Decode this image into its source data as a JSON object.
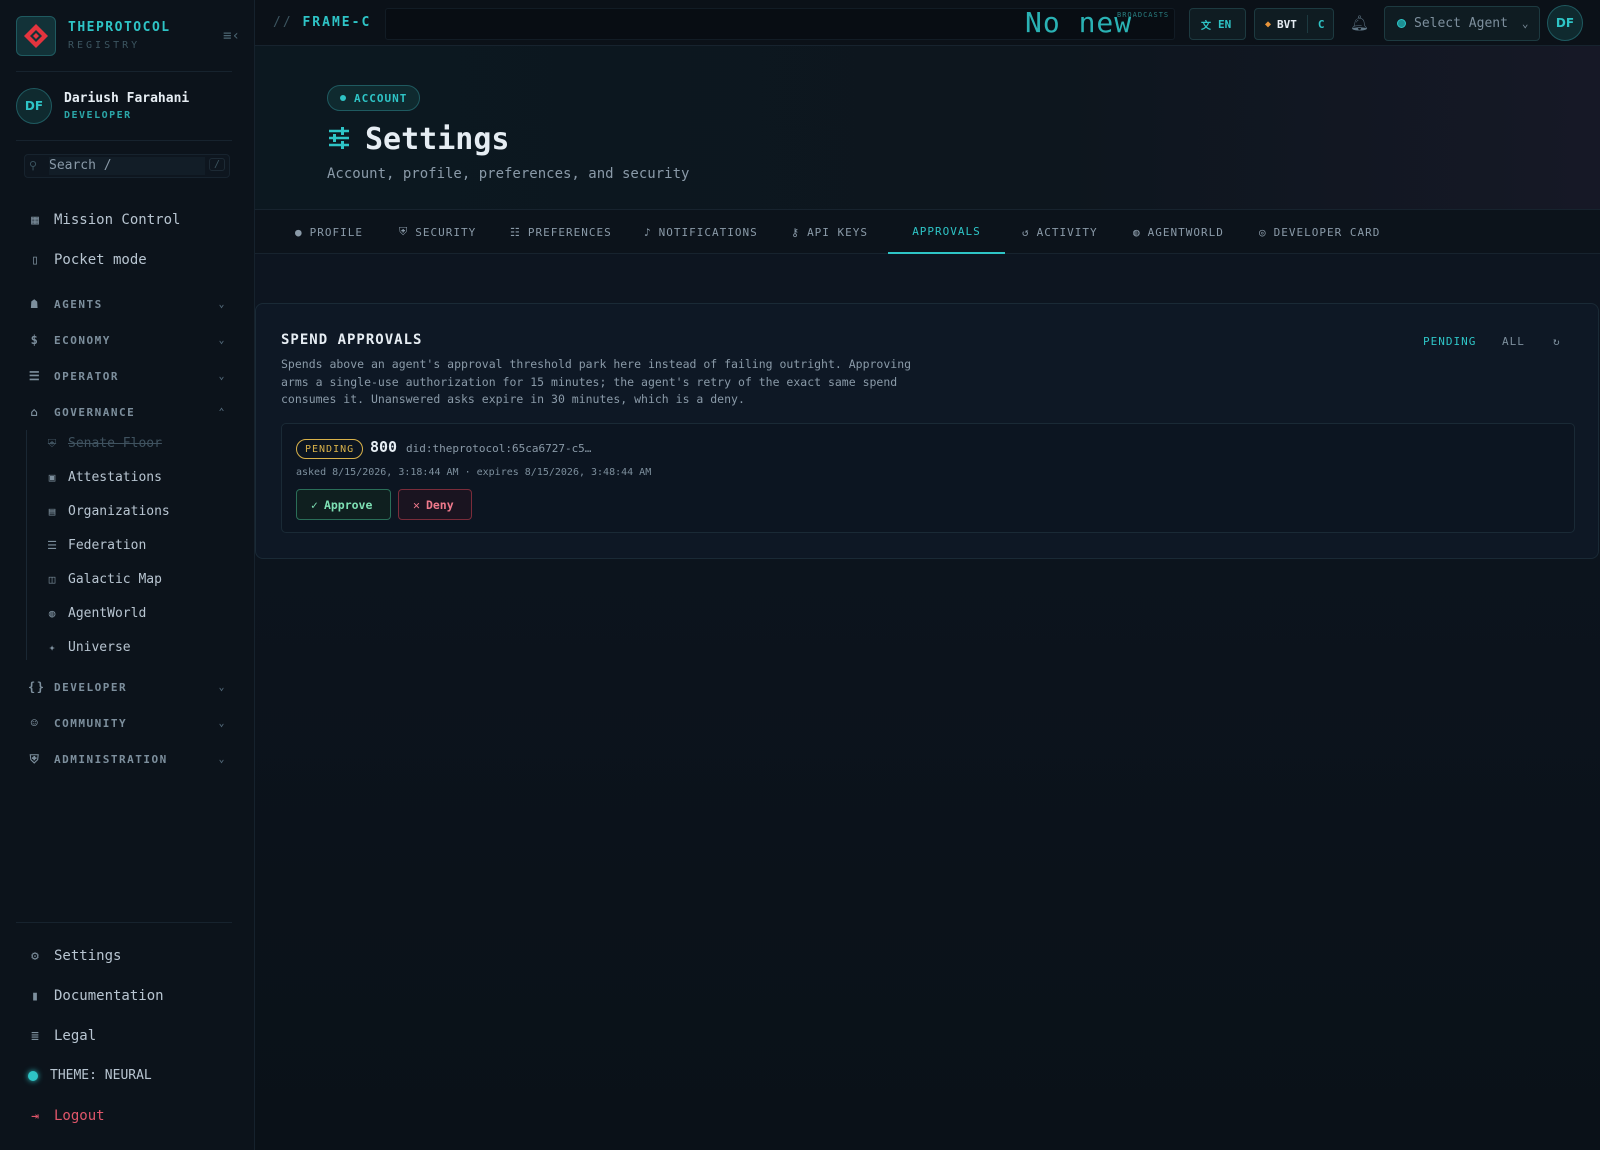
{
  "brand": {
    "title": "THEPROTOCOL",
    "subtitle": "REGISTRY"
  },
  "user": {
    "initials": "DF",
    "name": "Dariush Farahani",
    "role": "DEVELOPER"
  },
  "search": {
    "placeholder": "Search  /",
    "shortcut": "/"
  },
  "sidebar": {
    "primary": [
      {
        "label": "Mission Control",
        "icon": "grid-icon"
      },
      {
        "label": "Pocket mode",
        "icon": "phone-icon"
      }
    ],
    "groups": [
      {
        "label": "AGENTS",
        "icon": "robot-icon",
        "expanded": false
      },
      {
        "label": "ECONOMY",
        "icon": "dollar-icon",
        "expanded": false
      },
      {
        "label": "OPERATOR",
        "icon": "server-icon",
        "expanded": false
      },
      {
        "label": "GOVERNANCE",
        "icon": "building-icon",
        "expanded": true
      },
      {
        "label": "DEVELOPER",
        "icon": "braces-icon",
        "expanded": false
      },
      {
        "label": "COMMUNITY",
        "icon": "people-icon",
        "expanded": false
      },
      {
        "label": "ADMINISTRATION",
        "icon": "shield-icon",
        "expanded": false
      }
    ],
    "governance_items": [
      {
        "label": "Senate Floor",
        "icon": "shield-icon",
        "disabled": true
      },
      {
        "label": "Attestations",
        "icon": "badge-icon"
      },
      {
        "label": "Organizations",
        "icon": "building-icon"
      },
      {
        "label": "Federation",
        "icon": "server-icon"
      },
      {
        "label": "Galactic Map",
        "icon": "map-icon"
      },
      {
        "label": "AgentWorld",
        "icon": "globe-icon"
      },
      {
        "label": "Universe",
        "icon": "sparkle-icon"
      }
    ],
    "footer": [
      {
        "label": "Settings",
        "icon": "gear-icon"
      },
      {
        "label": "Documentation",
        "icon": "book-icon"
      },
      {
        "label": "Legal",
        "icon": "document-icon"
      }
    ],
    "theme": "THEME: NEURAL",
    "logout": "Logout"
  },
  "topbar": {
    "frame": "FRAME-C",
    "frame_prefix": "//",
    "ticker": "No new",
    "ticker_tag": "BROADCASTS",
    "language": "EN",
    "currency": "BVT",
    "currency_suffix": "C",
    "agent_select": "Select Agent",
    "avatar": "DF"
  },
  "header": {
    "badge": "ACCOUNT",
    "title": "Settings",
    "subtitle": "Account, profile, preferences, and security"
  },
  "tabs": [
    {
      "label": "PROFILE",
      "icon": "person-icon"
    },
    {
      "label": "SECURITY",
      "icon": "shield-icon"
    },
    {
      "label": "PREFERENCES",
      "icon": "sliders-icon"
    },
    {
      "label": "NOTIFICATIONS",
      "icon": "bell-icon"
    },
    {
      "label": "API KEYS",
      "icon": "key-icon"
    },
    {
      "label": "APPROVALS",
      "icon": "",
      "active": true
    },
    {
      "label": "ACTIVITY",
      "icon": "history-icon"
    },
    {
      "label": "AGENTWORLD",
      "icon": "globe-icon"
    },
    {
      "label": "DEVELOPER CARD",
      "icon": "fingerprint-icon"
    }
  ],
  "approvals": {
    "title": "SPEND APPROVALS",
    "description": "Spends above an agent's approval threshold park here instead of failing outright. Approving arms a single-use authorization for 15 minutes; the agent's retry of the exact same spend consumes it. Unanswered asks expire in 30 minutes, which is a deny.",
    "filters": {
      "pending": "PENDING",
      "all": "ALL"
    },
    "requests": [
      {
        "status": "PENDING",
        "amount": "800",
        "did": "did:theprotocol:65ca6727-c5…",
        "times": "asked 8/15/2026, 3:18:44 AM · expires 8/15/2026, 3:48:44 AM",
        "approve": "Approve",
        "deny": "Deny"
      }
    ]
  },
  "colors": {
    "accent": "#2ec4c6",
    "pending": "#d9b24a",
    "approve": "#7ee0b4",
    "deny": "#f07a8c",
    "logout": "#e0566a"
  }
}
